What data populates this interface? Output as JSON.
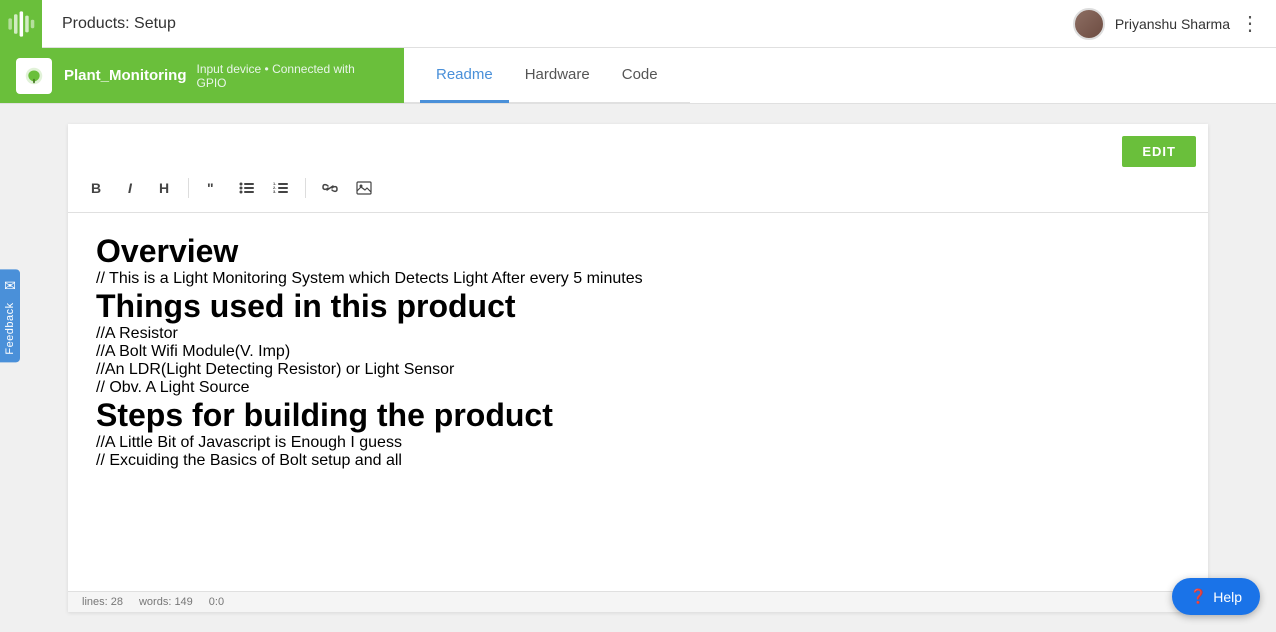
{
  "navbar": {
    "title": "Products: Setup",
    "user_name": "Priyanshu Sharma"
  },
  "product": {
    "name": "Plant_Monitoring",
    "description": "Input device • Connected with GPIO"
  },
  "tabs": [
    {
      "id": "readme",
      "label": "Readme",
      "active": true
    },
    {
      "id": "hardware",
      "label": "Hardware"
    },
    {
      "id": "code",
      "label": "Code"
    }
  ],
  "editor": {
    "edit_label": "EDIT",
    "toolbar": {
      "bold": "B",
      "italic": "I",
      "heading": "H",
      "quote": "“",
      "unordered_list": "•",
      "ordered_list": "1.",
      "link": "🔗",
      "image": "🖼"
    },
    "content": {
      "section1_heading": "Overview",
      "section1_text": "// This is a Light Monitoring System which Detects Light After every 5 minutes",
      "section2_heading": "Things used in this product",
      "section2_items": [
        "//A Resistor",
        "//A Bolt Wifi Module(V. Imp)",
        "//An LDR(Light Detecting Resistor) or Light Sensor",
        "// Obv. A Light Source"
      ],
      "section3_heading": "Steps for building the product",
      "section3_items": [
        "//A Little Bit of Javascript is Enough I guess",
        "// Excuiding the Basics of Bolt setup and all"
      ]
    },
    "status": {
      "lines": "lines: 28",
      "words": "words: 149",
      "cursor": "0:0"
    }
  },
  "feedback": {
    "label": "Feedback",
    "email_icon": "✉"
  },
  "help": {
    "label": "❓ Help"
  }
}
